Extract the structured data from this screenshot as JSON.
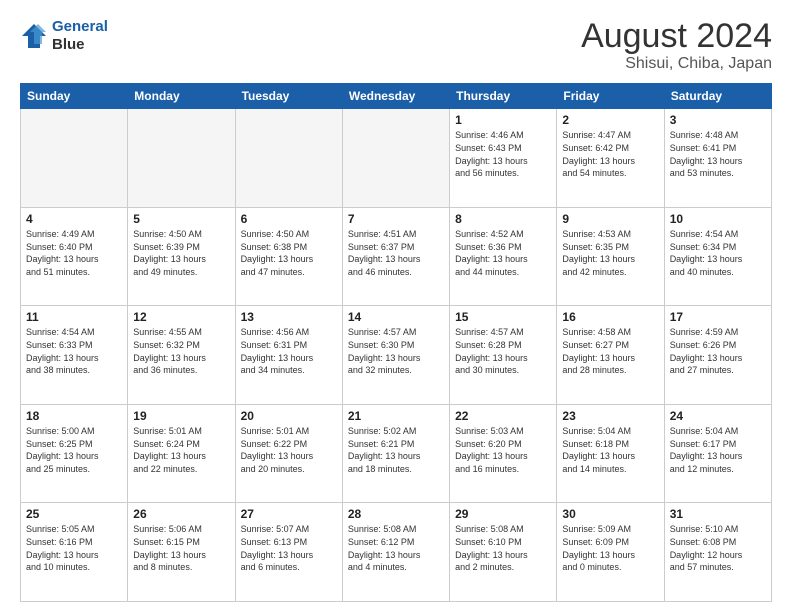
{
  "header": {
    "logo_line1": "General",
    "logo_line2": "Blue",
    "main_title": "August 2024",
    "subtitle": "Shisui, Chiba, Japan"
  },
  "days_of_week": [
    "Sunday",
    "Monday",
    "Tuesday",
    "Wednesday",
    "Thursday",
    "Friday",
    "Saturday"
  ],
  "weeks": [
    [
      {
        "day": "",
        "info": ""
      },
      {
        "day": "",
        "info": ""
      },
      {
        "day": "",
        "info": ""
      },
      {
        "day": "",
        "info": ""
      },
      {
        "day": "1",
        "info": "Sunrise: 4:46 AM\nSunset: 6:43 PM\nDaylight: 13 hours\nand 56 minutes."
      },
      {
        "day": "2",
        "info": "Sunrise: 4:47 AM\nSunset: 6:42 PM\nDaylight: 13 hours\nand 54 minutes."
      },
      {
        "day": "3",
        "info": "Sunrise: 4:48 AM\nSunset: 6:41 PM\nDaylight: 13 hours\nand 53 minutes."
      }
    ],
    [
      {
        "day": "4",
        "info": "Sunrise: 4:49 AM\nSunset: 6:40 PM\nDaylight: 13 hours\nand 51 minutes."
      },
      {
        "day": "5",
        "info": "Sunrise: 4:50 AM\nSunset: 6:39 PM\nDaylight: 13 hours\nand 49 minutes."
      },
      {
        "day": "6",
        "info": "Sunrise: 4:50 AM\nSunset: 6:38 PM\nDaylight: 13 hours\nand 47 minutes."
      },
      {
        "day": "7",
        "info": "Sunrise: 4:51 AM\nSunset: 6:37 PM\nDaylight: 13 hours\nand 46 minutes."
      },
      {
        "day": "8",
        "info": "Sunrise: 4:52 AM\nSunset: 6:36 PM\nDaylight: 13 hours\nand 44 minutes."
      },
      {
        "day": "9",
        "info": "Sunrise: 4:53 AM\nSunset: 6:35 PM\nDaylight: 13 hours\nand 42 minutes."
      },
      {
        "day": "10",
        "info": "Sunrise: 4:54 AM\nSunset: 6:34 PM\nDaylight: 13 hours\nand 40 minutes."
      }
    ],
    [
      {
        "day": "11",
        "info": "Sunrise: 4:54 AM\nSunset: 6:33 PM\nDaylight: 13 hours\nand 38 minutes."
      },
      {
        "day": "12",
        "info": "Sunrise: 4:55 AM\nSunset: 6:32 PM\nDaylight: 13 hours\nand 36 minutes."
      },
      {
        "day": "13",
        "info": "Sunrise: 4:56 AM\nSunset: 6:31 PM\nDaylight: 13 hours\nand 34 minutes."
      },
      {
        "day": "14",
        "info": "Sunrise: 4:57 AM\nSunset: 6:30 PM\nDaylight: 13 hours\nand 32 minutes."
      },
      {
        "day": "15",
        "info": "Sunrise: 4:57 AM\nSunset: 6:28 PM\nDaylight: 13 hours\nand 30 minutes."
      },
      {
        "day": "16",
        "info": "Sunrise: 4:58 AM\nSunset: 6:27 PM\nDaylight: 13 hours\nand 28 minutes."
      },
      {
        "day": "17",
        "info": "Sunrise: 4:59 AM\nSunset: 6:26 PM\nDaylight: 13 hours\nand 27 minutes."
      }
    ],
    [
      {
        "day": "18",
        "info": "Sunrise: 5:00 AM\nSunset: 6:25 PM\nDaylight: 13 hours\nand 25 minutes."
      },
      {
        "day": "19",
        "info": "Sunrise: 5:01 AM\nSunset: 6:24 PM\nDaylight: 13 hours\nand 22 minutes."
      },
      {
        "day": "20",
        "info": "Sunrise: 5:01 AM\nSunset: 6:22 PM\nDaylight: 13 hours\nand 20 minutes."
      },
      {
        "day": "21",
        "info": "Sunrise: 5:02 AM\nSunset: 6:21 PM\nDaylight: 13 hours\nand 18 minutes."
      },
      {
        "day": "22",
        "info": "Sunrise: 5:03 AM\nSunset: 6:20 PM\nDaylight: 13 hours\nand 16 minutes."
      },
      {
        "day": "23",
        "info": "Sunrise: 5:04 AM\nSunset: 6:18 PM\nDaylight: 13 hours\nand 14 minutes."
      },
      {
        "day": "24",
        "info": "Sunrise: 5:04 AM\nSunset: 6:17 PM\nDaylight: 13 hours\nand 12 minutes."
      }
    ],
    [
      {
        "day": "25",
        "info": "Sunrise: 5:05 AM\nSunset: 6:16 PM\nDaylight: 13 hours\nand 10 minutes."
      },
      {
        "day": "26",
        "info": "Sunrise: 5:06 AM\nSunset: 6:15 PM\nDaylight: 13 hours\nand 8 minutes."
      },
      {
        "day": "27",
        "info": "Sunrise: 5:07 AM\nSunset: 6:13 PM\nDaylight: 13 hours\nand 6 minutes."
      },
      {
        "day": "28",
        "info": "Sunrise: 5:08 AM\nSunset: 6:12 PM\nDaylight: 13 hours\nand 4 minutes."
      },
      {
        "day": "29",
        "info": "Sunrise: 5:08 AM\nSunset: 6:10 PM\nDaylight: 13 hours\nand 2 minutes."
      },
      {
        "day": "30",
        "info": "Sunrise: 5:09 AM\nSunset: 6:09 PM\nDaylight: 13 hours\nand 0 minutes."
      },
      {
        "day": "31",
        "info": "Sunrise: 5:10 AM\nSunset: 6:08 PM\nDaylight: 12 hours\nand 57 minutes."
      }
    ]
  ]
}
